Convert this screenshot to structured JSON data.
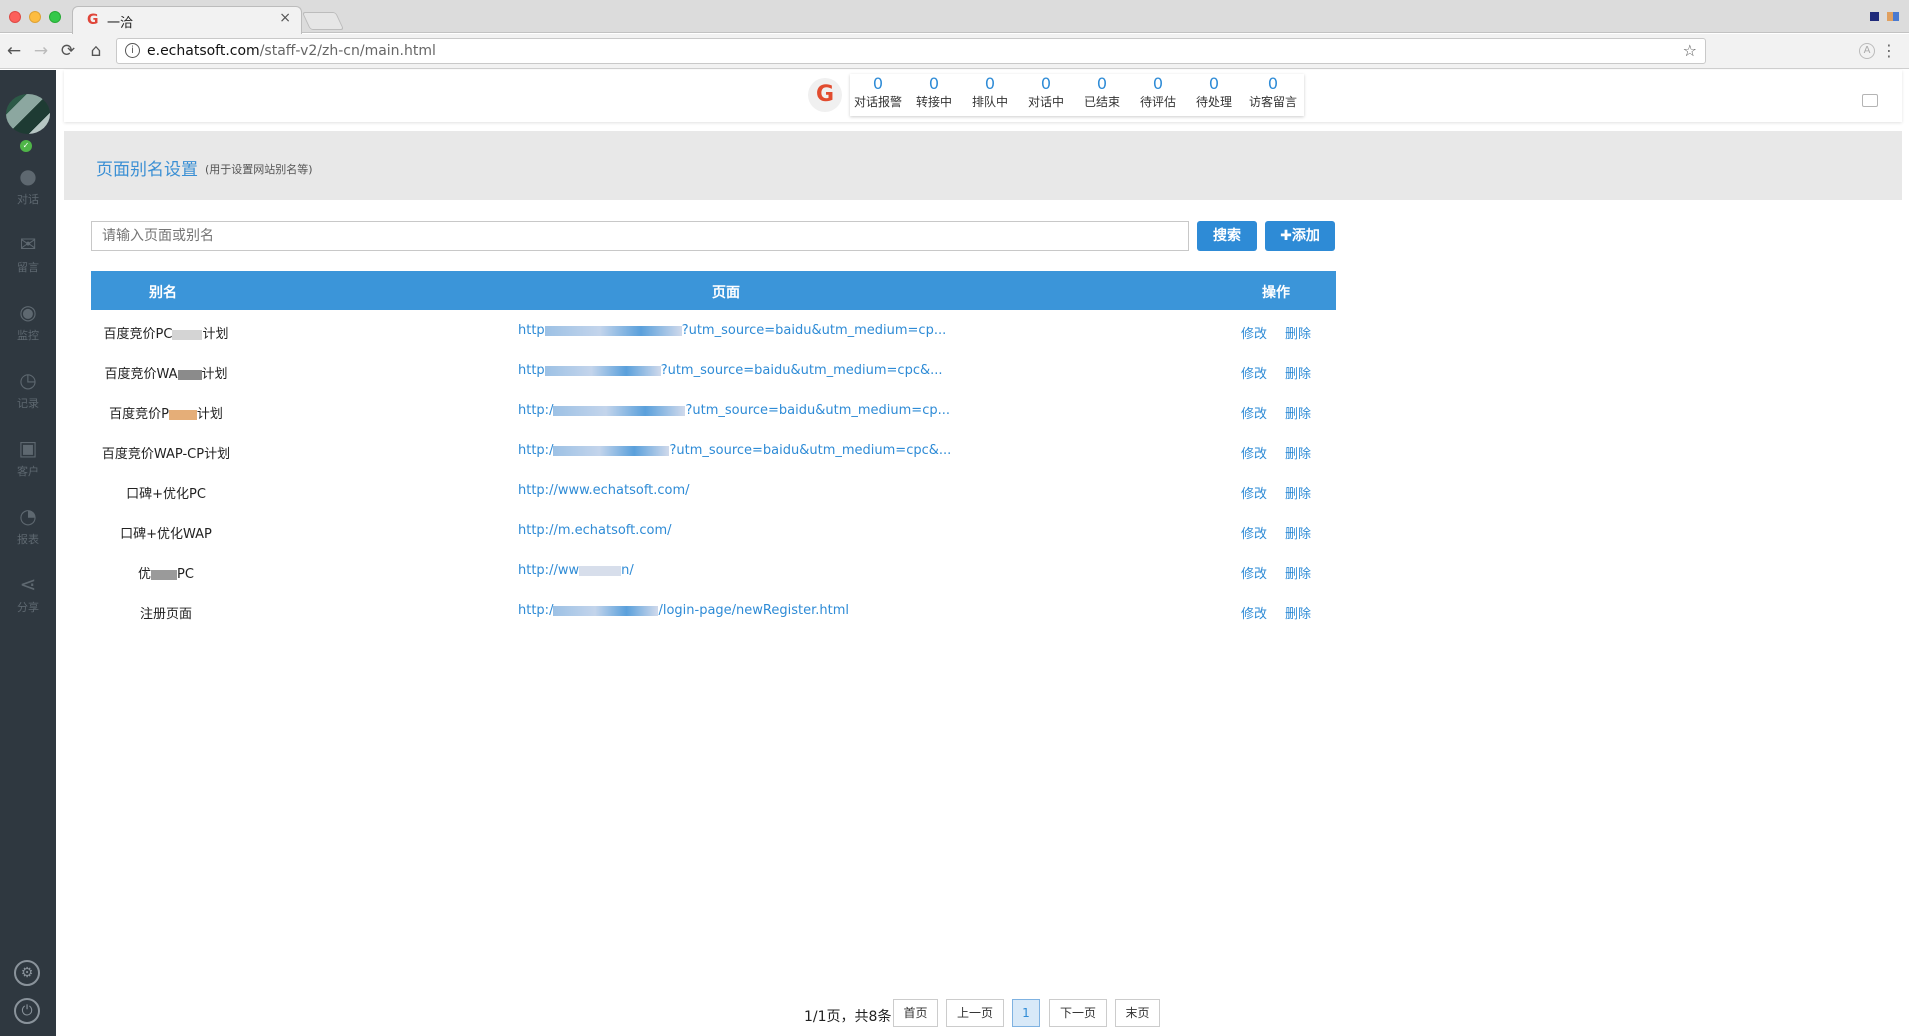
{
  "browser": {
    "tab_title": "一洽",
    "tab_close": "×",
    "favicon": "G",
    "url_host": "e.echatsoft.com",
    "url_path": "/staff-v2/zh-cn/main.html",
    "back": "←",
    "forward": "→",
    "reload": "⟳",
    "home": "⌂",
    "info": "i",
    "star": "☆",
    "menu": "⋮",
    "profile": "A"
  },
  "sidebar": {
    "items": [
      {
        "icon": "chat-bubble-icon",
        "glyph": "●",
        "label": "对话"
      },
      {
        "icon": "mail-icon",
        "glyph": "✉",
        "label": "留言"
      },
      {
        "icon": "eye-icon",
        "glyph": "◉",
        "label": "监控"
      },
      {
        "icon": "clock-icon",
        "glyph": "◷",
        "label": "记录"
      },
      {
        "icon": "contact-card-icon",
        "glyph": "▣",
        "label": "客户"
      },
      {
        "icon": "pie-chart-icon",
        "glyph": "◔",
        "label": "报表"
      },
      {
        "icon": "share-icon",
        "glyph": "⋖",
        "label": "分享"
      }
    ],
    "settings_glyph": "⚙",
    "power_glyph": "⏻",
    "online_glyph": "✓"
  },
  "topbar": {
    "logo": "G",
    "stats": [
      {
        "num": "0",
        "label": "对话报警"
      },
      {
        "num": "0",
        "label": "转接中"
      },
      {
        "num": "0",
        "label": "排队中"
      },
      {
        "num": "0",
        "label": "对话中"
      },
      {
        "num": "0",
        "label": "已结束"
      },
      {
        "num": "0",
        "label": "待评估"
      },
      {
        "num": "0",
        "label": "待处理"
      },
      {
        "num": "0",
        "label": "访客留言"
      }
    ]
  },
  "header": {
    "title": "页面别名设置",
    "subtitle": "(用于设置网站别名等)"
  },
  "search": {
    "placeholder": "请输入页面或别名",
    "search_label": "搜索",
    "add_label": "✚添加"
  },
  "table": {
    "columns": [
      "别名",
      "页面",
      "操作"
    ],
    "edit_label": "修改",
    "delete_label": "删除",
    "rows": [
      {
        "alias_a": "百度竞价PC",
        "alias_b": "计划",
        "page_a": "http",
        "page_b": "?utm_source=baidu&utm_medium=cp..."
      },
      {
        "alias_a": "百度竞价WA",
        "alias_b": "计划",
        "page_a": "http",
        "page_b": "?utm_source=baidu&utm_medium=cpc&..."
      },
      {
        "alias_a": "百度竞价P",
        "alias_b": "计划",
        "page_a": "http:/",
        "page_b": "?utm_source=baidu&utm_medium=cp..."
      },
      {
        "alias_a": "百度竞价WAP-CP计划",
        "alias_b": "",
        "page_a": "http:/",
        "page_b": "?utm_source=baidu&utm_medium=cpc&..."
      },
      {
        "alias_a": "口碑+优化PC",
        "alias_b": "",
        "page_a": "http://www.echatsoft.com/",
        "page_b": ""
      },
      {
        "alias_a": "口碑+优化WAP",
        "alias_b": "",
        "page_a": "http://m.echatsoft.com/",
        "page_b": ""
      },
      {
        "alias_a": "优",
        "alias_b": "PC",
        "page_a": "http://ww",
        "page_b": "n/"
      },
      {
        "alias_a": "注册页面",
        "alias_b": "",
        "page_a": "http:/",
        "page_b": "/login-page/newRegister.html"
      }
    ]
  },
  "pagination": {
    "info": "1/1页，共8条",
    "first": "首页",
    "prev": "上一页",
    "current": "1",
    "next": "下一页",
    "last": "末页"
  }
}
